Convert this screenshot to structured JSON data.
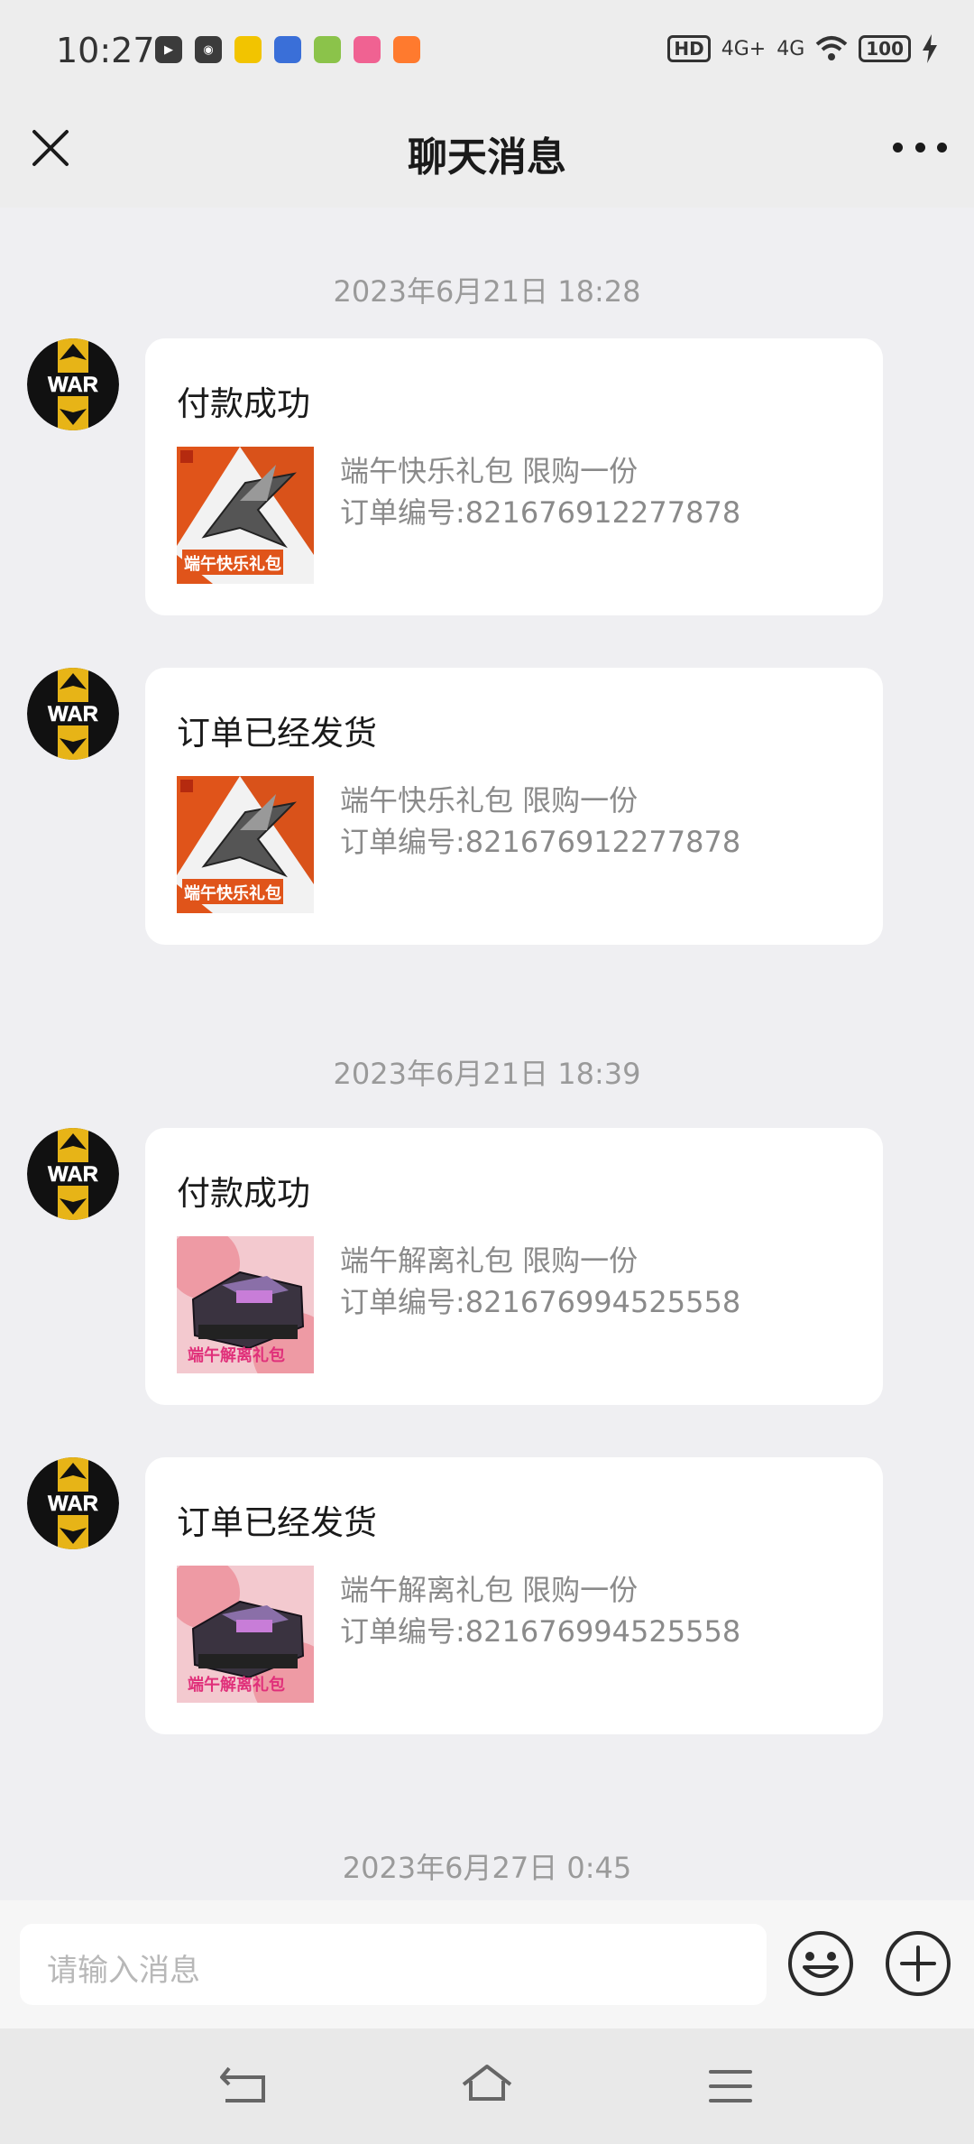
{
  "status_bar": {
    "time": "10:27",
    "hd": "HD",
    "net1": "4G+",
    "net2": "4G",
    "battery": "100"
  },
  "status_apps": [
    {
      "icon": "play-icon",
      "bg": "#3b3b3b",
      "label": "▶"
    },
    {
      "icon": "video-icon",
      "bg": "#3b3b3b",
      "label": "◉"
    },
    {
      "icon": "app-yellow-icon",
      "bg": "#f2c400",
      "label": ""
    },
    {
      "icon": "app-blue-icon",
      "bg": "#3a6fd8",
      "label": ""
    },
    {
      "icon": "app-green-icon",
      "bg": "#8bc34a",
      "label": ""
    },
    {
      "icon": "app-pink-icon",
      "bg": "#f06292",
      "label": ""
    },
    {
      "icon": "app-orange-icon",
      "bg": "#ff7a2e",
      "label": ""
    }
  ],
  "header": {
    "title": "聊天消息"
  },
  "messages": [
    {
      "timestamp": "2023年6月21日 18:28",
      "title": "付款成功",
      "item": "端午快乐礼包 限购一份",
      "order": "订单编号:821676912277878",
      "thumb": "orange"
    },
    {
      "timestamp": "",
      "title": "订单已经发货",
      "item": "端午快乐礼包 限购一份",
      "order": "订单编号:821676912277878",
      "thumb": "orange"
    },
    {
      "timestamp": "2023年6月21日 18:39",
      "title": "付款成功",
      "item": "端午解离礼包 限购一份",
      "order": "订单编号:821676994525558",
      "thumb": "pink"
    },
    {
      "timestamp": "",
      "title": "订单已经发货",
      "item": "端午解离礼包 限购一份",
      "order": "订单编号:821676994525558",
      "thumb": "pink"
    }
  ],
  "last_timestamp": "2023年6月27日 0:45",
  "thumb_captions": {
    "orange": "端午快乐礼包",
    "pink": "端午解离礼包"
  },
  "input": {
    "placeholder": "请输入消息"
  },
  "colors": {
    "background": "#efeff2",
    "card": "#ffffff",
    "avatar_yellow": "#e7b417",
    "avatar_black": "#111111"
  }
}
